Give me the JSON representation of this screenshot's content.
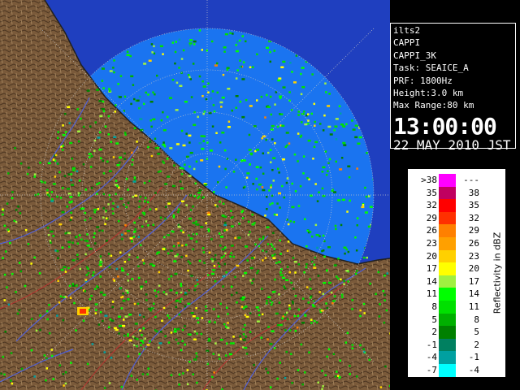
{
  "info": {
    "radar_name": "ilts2",
    "product": "CAPPI",
    "product_id": "CAPPI_3K",
    "task": "Task: SEAICE_A",
    "prf": "PRF: 1800Hz",
    "height": "Height:3.0 km",
    "max_range": "Max Range:80 km",
    "time": "13:00:00",
    "date": "22 MAY 2010 JST"
  },
  "legend": {
    "title": "Reflectivity in dBZ",
    "rows": [
      {
        "lo": ">38",
        "hi": "---",
        "color": "#ff00ff"
      },
      {
        "lo": "35",
        "hi": "38",
        "color": "#c00060"
      },
      {
        "lo": "32",
        "hi": "35",
        "color": "#ff0000"
      },
      {
        "lo": "29",
        "hi": "32",
        "color": "#ff3000"
      },
      {
        "lo": "26",
        "hi": "29",
        "color": "#ff8000"
      },
      {
        "lo": "23",
        "hi": "26",
        "color": "#ffa000"
      },
      {
        "lo": "20",
        "hi": "23",
        "color": "#ffd000"
      },
      {
        "lo": "17",
        "hi": "20",
        "color": "#ffff00"
      },
      {
        "lo": "14",
        "hi": "17",
        "color": "#a0f040"
      },
      {
        "lo": "11",
        "hi": "14",
        "color": "#00ff00"
      },
      {
        "lo": "8",
        "hi": "11",
        "color": "#00e000"
      },
      {
        "lo": "5",
        "hi": "8",
        "color": "#00b000"
      },
      {
        "lo": "2",
        "hi": "5",
        "color": "#008000"
      },
      {
        "lo": "-1",
        "hi": "2",
        "color": "#008060"
      },
      {
        "lo": "-4",
        "hi": "-1",
        "color": "#00a0a0"
      },
      {
        "lo": "-7",
        "hi": "-4",
        "color": "#00ffff"
      }
    ]
  },
  "colors": {
    "sea_dark": "#1f3fbf",
    "sea_coverage": "#1a74f0",
    "land": "#7a5a3a",
    "rivers": "#5060d8",
    "borders": "#c03030"
  }
}
